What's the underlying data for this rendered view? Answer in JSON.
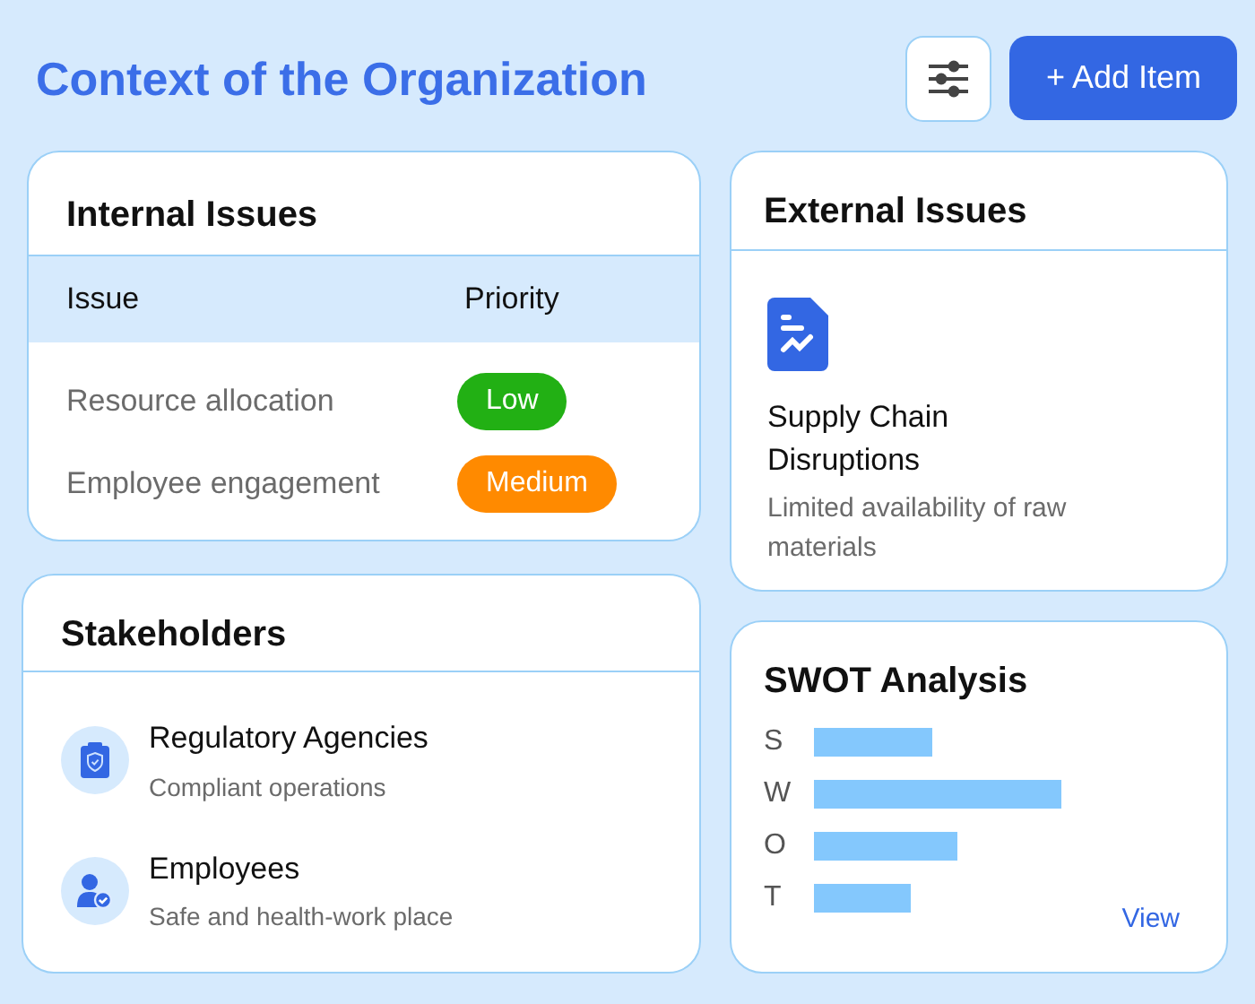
{
  "header": {
    "title": "Context of the Organization",
    "add_button": "+ Add Item"
  },
  "internal_issues": {
    "title": "Internal Issues",
    "columns": [
      "Issue",
      "Priority"
    ],
    "rows": [
      {
        "issue": "Resource allocation",
        "priority": "Low",
        "color": "#22b014"
      },
      {
        "issue": "Employee engagement",
        "priority": "Medium",
        "color": "#ff8a00"
      }
    ]
  },
  "stakeholders": {
    "title": "Stakeholders",
    "items": [
      {
        "kind": "agency",
        "name": "Regulatory Agencies",
        "description": "Compliant operations"
      },
      {
        "kind": "person",
        "name": "Employees",
        "description": "Safe and health-work place"
      }
    ]
  },
  "external_issues": {
    "title": "External Issues",
    "items": [
      {
        "title": "Supply Chain Disruptions",
        "description": "Limited availability of raw materials"
      }
    ]
  },
  "swot": {
    "title": "SWOT Analysis",
    "rows": [
      {
        "label": "S"
      },
      {
        "label": "W"
      },
      {
        "label": "O"
      },
      {
        "label": "T"
      }
    ],
    "link": "View"
  }
}
